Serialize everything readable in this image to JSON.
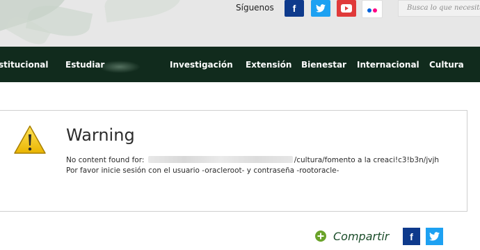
{
  "header": {
    "follow_label": "Síguenos",
    "social": [
      {
        "name": "facebook",
        "glyph": "f",
        "color": "#0e3a8c"
      },
      {
        "name": "twitter",
        "glyph": "🐦",
        "color": "#1da1f2"
      },
      {
        "name": "youtube",
        "glyph": "▶",
        "color": "#e03a3a"
      },
      {
        "name": "flickr",
        "glyph": "",
        "color": "#ffffff"
      }
    ],
    "search_placeholder": "Busca lo que necesitas"
  },
  "nav": {
    "items": [
      "stitucional",
      "Estudiar",
      "Investigación",
      "Extensión",
      "Bienestar",
      "Internacional",
      "Cultura"
    ]
  },
  "warning": {
    "title": "Warning",
    "line1_prefix": "No content found for: ",
    "line1_suffix": "/cultura/fomento a la creaci!c3!b3n/jvjh",
    "line2": "Por favor inicie sesión con el usuario -oracleroot- y contraseña -rootoracle-"
  },
  "share": {
    "label": "Compartir"
  },
  "colors": {
    "nav_bg": "#112b1d",
    "accent_green": "#1b4d2a",
    "facebook": "#0e3a8c",
    "twitter": "#1da1f2",
    "youtube": "#e03a3a",
    "warning_yellow": "#f2c40f"
  }
}
